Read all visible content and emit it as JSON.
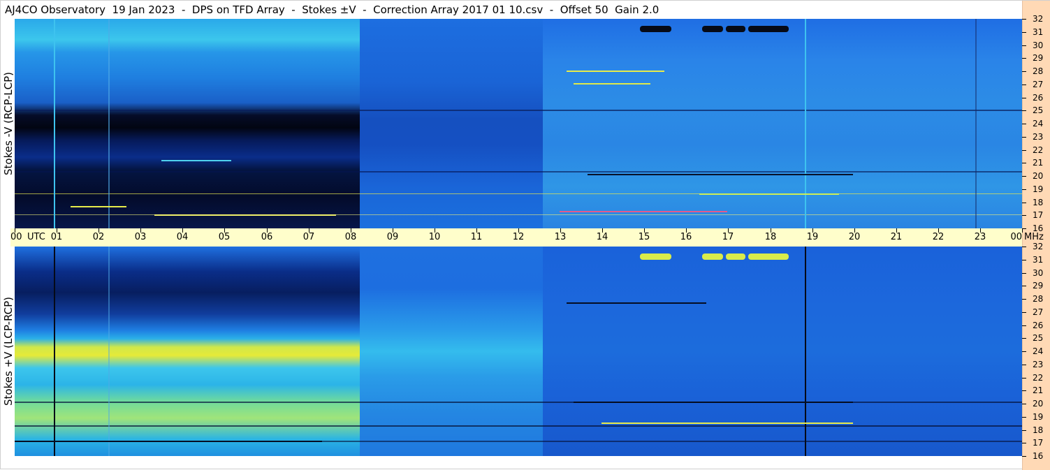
{
  "window": {
    "title": "AJ4CO Observatory  19 Jan 2023  -  DPS on TFD Array  -  Stokes ±V  -  Correction Array 2017 01 10.csv  -  Offset 50  Gain 2.0"
  },
  "panels": {
    "top": {
      "ylabel": "Stokes -V (RCP-LCP)"
    },
    "bottom": {
      "ylabel": "Stokes +V (LCP-RCP)"
    }
  },
  "time_axis": {
    "labels": [
      "00",
      "01",
      "02",
      "03",
      "04",
      "05",
      "06",
      "07",
      "08",
      "09",
      "10",
      "11",
      "12",
      "13",
      "14",
      "15",
      "16",
      "17",
      "18",
      "19",
      "20",
      "21",
      "22",
      "23",
      "00"
    ],
    "utc_label": "UTC",
    "unit_label": "MHz"
  },
  "freq_axis": {
    "labels": [
      "32",
      "31",
      "30",
      "29",
      "28",
      "27",
      "26",
      "25",
      "24",
      "23",
      "22",
      "21",
      "20",
      "19",
      "18",
      "17",
      "16"
    ]
  },
  "colors": {
    "background": "#ffffff",
    "axis_strip": "#fffecb",
    "side_strip": "#ffd9b5",
    "spectrogram_dark": "#050a1e",
    "spectrogram_mid": "#1f6fe0",
    "spectrogram_cyan": "#3fc0ee",
    "spectrogram_yellow": "#e9ec3a"
  }
}
